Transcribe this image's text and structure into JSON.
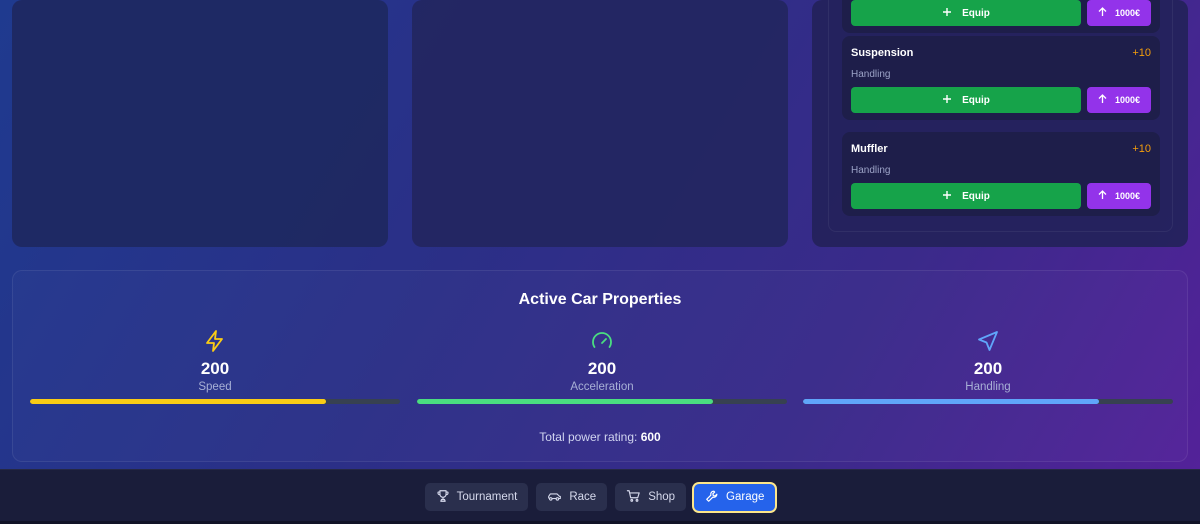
{
  "parts": [
    {
      "name": "",
      "bonus": "",
      "stat": "",
      "equip_label": "Equip",
      "upgrade_label": "1000€"
    },
    {
      "name": "Suspension",
      "bonus": "+10",
      "stat": "Handling",
      "equip_label": "Equip",
      "upgrade_label": "1000€"
    },
    {
      "name": "Muffler",
      "bonus": "+10",
      "stat": "Handling",
      "equip_label": "Equip",
      "upgrade_label": "1000€"
    }
  ],
  "properties": {
    "title": "Active Car Properties",
    "stats": [
      {
        "label": "Speed",
        "value": "200",
        "fill": 0.8,
        "color": "#facc15",
        "icon": "lightning-icon"
      },
      {
        "label": "Acceleration",
        "value": "200",
        "fill": 0.8,
        "color": "#4ade80",
        "icon": "gauge-icon"
      },
      {
        "label": "Handling",
        "value": "200",
        "fill": 0.8,
        "color": "#60a5fa",
        "icon": "navigation-arrow-icon"
      }
    ],
    "total_label": "Total power rating:",
    "total_value": "600"
  },
  "nav": {
    "tournament": "Tournament",
    "race": "Race",
    "shop": "Shop",
    "garage": "Garage",
    "active": "garage"
  }
}
